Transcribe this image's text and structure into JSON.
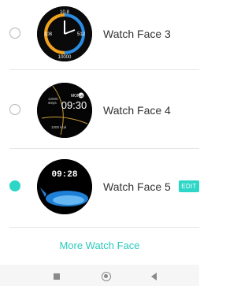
{
  "watch_faces": [
    {
      "label": "Watch Face 3",
      "selected": false,
      "preview": {
        "top": "10.8",
        "left": "108",
        "right": "512",
        "bottom": "10000",
        "theme": "orange-blue dial"
      }
    },
    {
      "label": "Watch Face 4",
      "selected": false,
      "preview": {
        "date": "MON",
        "day": "16",
        "time": "09:30",
        "steps": "12000",
        "steps_unit": "steps",
        "calories": "1000 kcal",
        "theme": "gold arcs"
      }
    },
    {
      "label": "Watch Face 5",
      "selected": true,
      "edit_label": "EDIT",
      "preview": {
        "time": "09:28",
        "theme": "blue whale"
      }
    }
  ],
  "more_link": "More Watch Face",
  "colors": {
    "accent": "#2dd6c6",
    "divider": "#e6e6e6",
    "text": "#333333"
  },
  "navbar": {
    "icons": [
      "square-recents-icon",
      "circle-home-icon",
      "triangle-back-icon"
    ]
  }
}
